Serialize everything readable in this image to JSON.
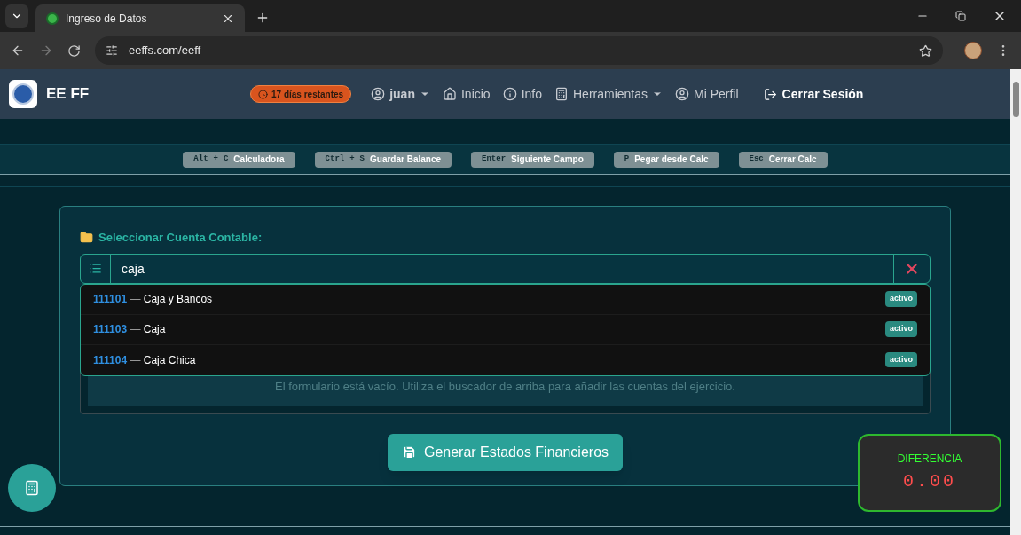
{
  "browser": {
    "tab_title": "Ingreso de Datos",
    "url": "eeffs.com/eeff"
  },
  "header": {
    "brand": "EE FF",
    "trial_badge": "17 días restantes",
    "nav": [
      {
        "label": "juan",
        "kind": "dropdown"
      },
      {
        "label": "Inicio",
        "kind": "link"
      },
      {
        "label": "Info",
        "kind": "link"
      },
      {
        "label": "Herramientas",
        "kind": "dropdown"
      },
      {
        "label": "Mi Perfil",
        "kind": "link"
      }
    ],
    "logout": "Cerrar Sesión"
  },
  "shortcuts": [
    {
      "keys": [
        "Alt",
        "+",
        "C"
      ],
      "label": "Calculadora"
    },
    {
      "keys": [
        "Ctrl",
        "+",
        "S"
      ],
      "label": "Guardar Balance"
    },
    {
      "keys": [
        "Enter"
      ],
      "label": "Siguiente Campo"
    },
    {
      "keys": [
        "P"
      ],
      "label": "Pegar desde Calc"
    },
    {
      "keys": [
        "Esc"
      ],
      "label": "Cerrar Calc"
    }
  ],
  "account_picker": {
    "label": "Seleccionar Cuenta Contable:",
    "value": "caja",
    "results": [
      {
        "code": "111101",
        "separator": "—",
        "name": "Caja y Bancos",
        "status": "activo"
      },
      {
        "code": "111103",
        "separator": "—",
        "name": "Caja",
        "status": "activo"
      },
      {
        "code": "111104",
        "separator": "—",
        "name": "Caja Chica",
        "status": "activo"
      }
    ]
  },
  "empty_message": "El formulario está vacío. Utiliza el buscador de arriba para añadir las cuentas del ejercicio.",
  "generate_button": "Generar Estados Financieros",
  "difference": {
    "label": "DIFERENCIA",
    "value": "0.00"
  }
}
